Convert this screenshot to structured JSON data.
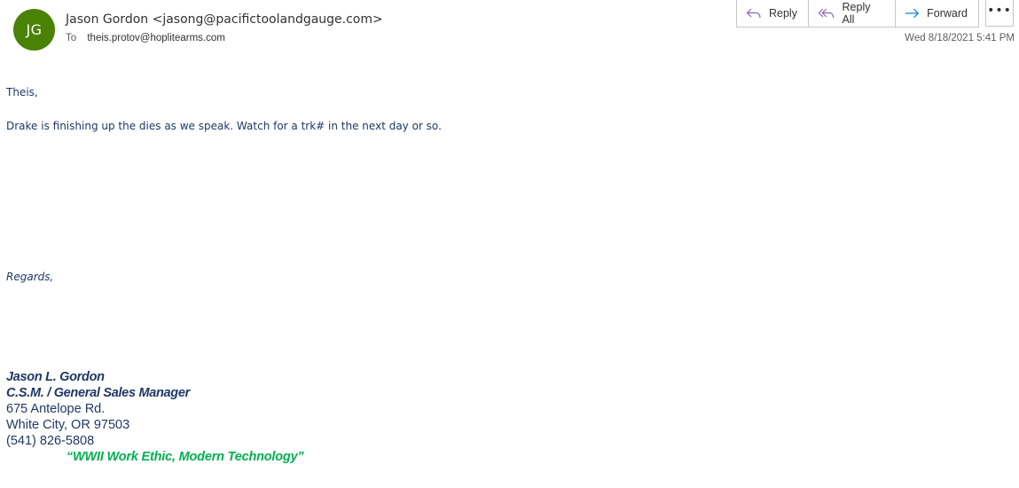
{
  "sender": {
    "initials": "JG",
    "avatar_color": "#498205",
    "display": "Jason Gordon <jasong@pacifictoolandgauge.com>"
  },
  "recipients": {
    "label": "To",
    "to": "theis.protov@hoplitearms.com"
  },
  "actions": {
    "reply": "Reply",
    "reply_all": "Reply All",
    "forward": "Forward",
    "more": "•••"
  },
  "date": "Wed 8/18/2021 5:41 PM",
  "body": {
    "greeting": "Theis,",
    "message": "Drake is finishing up the dies as we speak. Watch for a trk# in the next day or so.",
    "closing": "Regards,"
  },
  "signature": {
    "name": "Jason L. Gordon",
    "title": "C.S.M. / General Sales Manager",
    "street": "675 Antelope Rd.",
    "city": "White City, OR 97503",
    "phone": "(541) 826-5808",
    "motto": "“WWII Work Ethic, Modern Technology”",
    "text_color": "#1f3864",
    "motto_color": "#00b050"
  }
}
